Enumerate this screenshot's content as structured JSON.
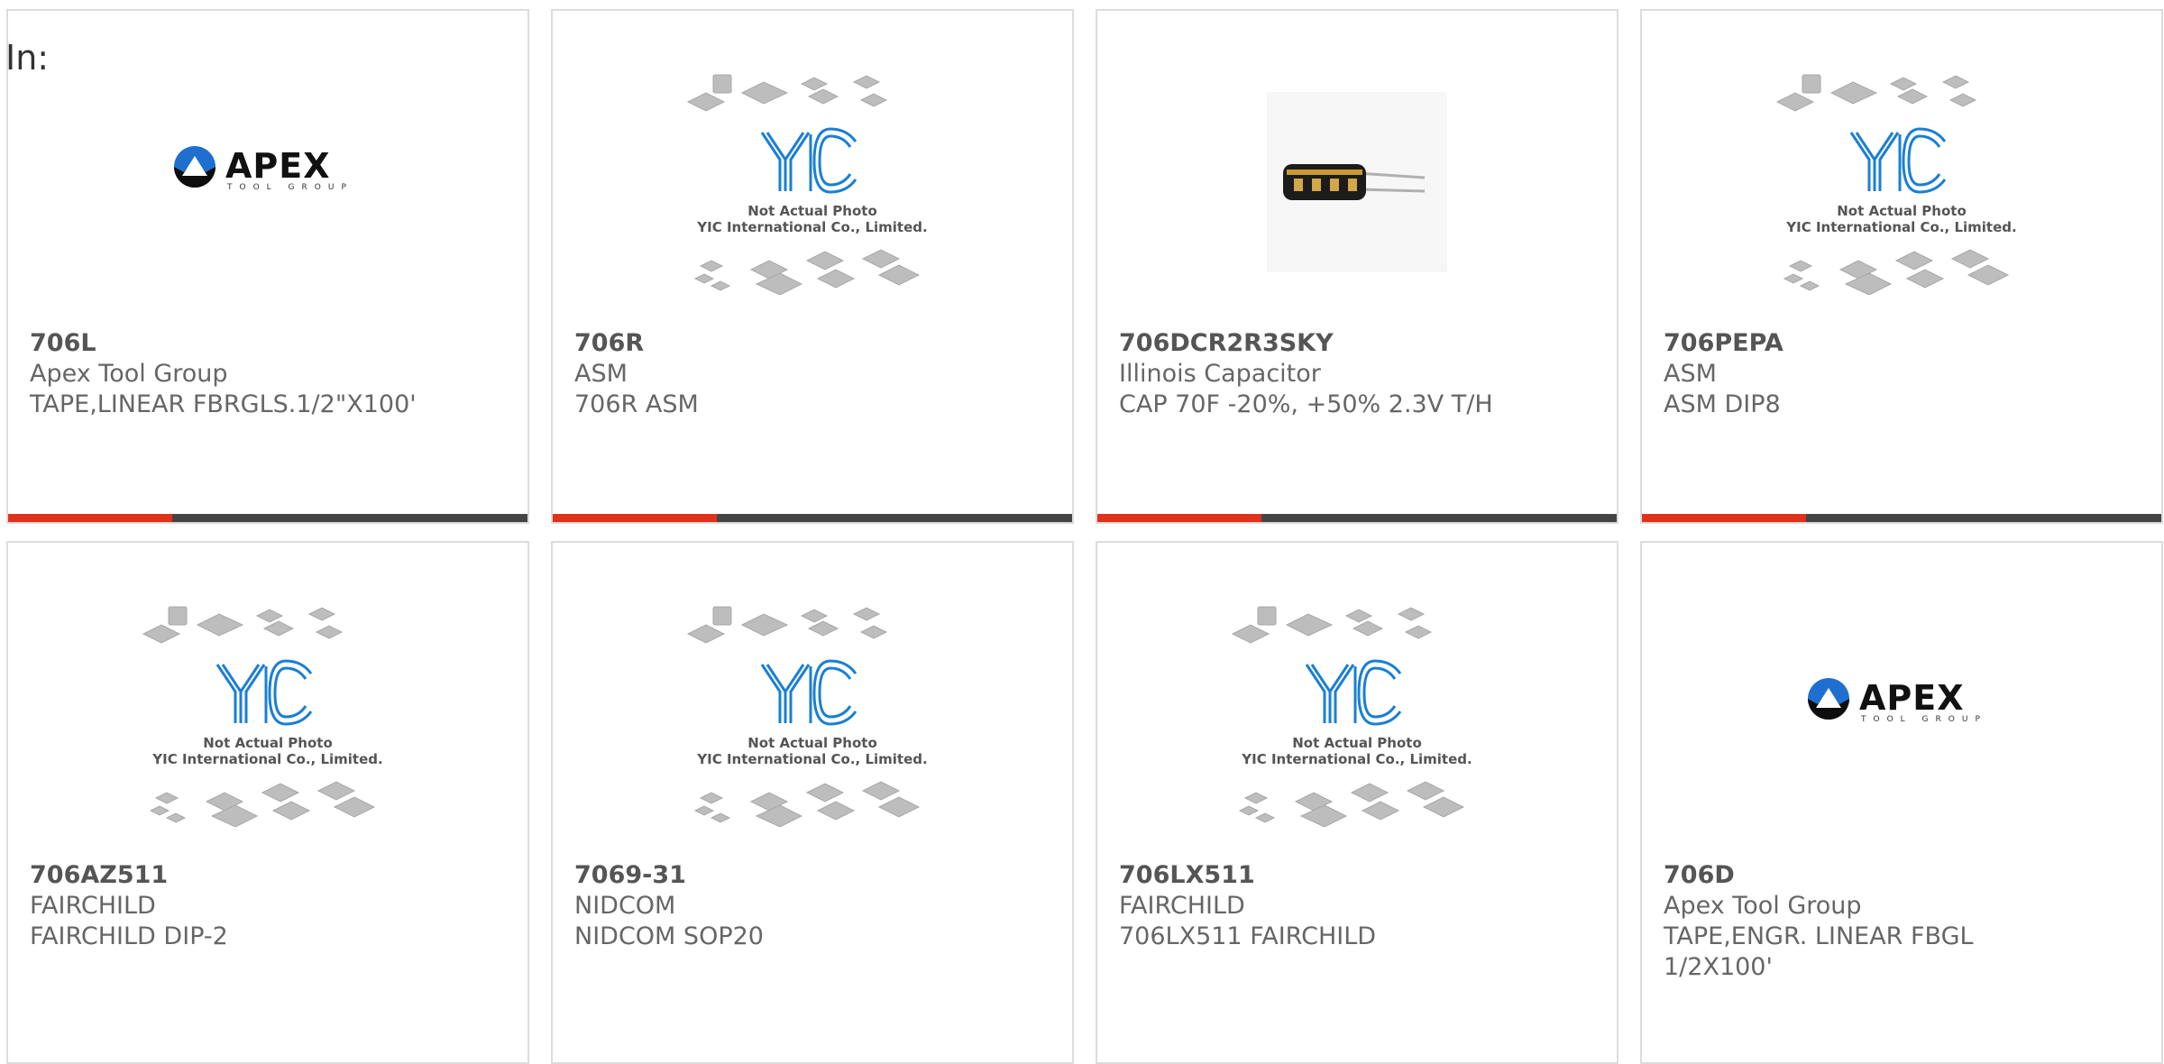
{
  "header": {
    "in_label": "In:"
  },
  "placeholder_text": {
    "line1": "Not Actual Photo",
    "line2": "YIC International Co., Limited.",
    "logo": "YIC"
  },
  "apex_logo": {
    "word": "APEX",
    "tag": "TOOL GROUP"
  },
  "colors": {
    "accent": "#e0321a",
    "bar": "#444444",
    "yic_blue": "#1a7fd4",
    "border": "#dcdcdc"
  },
  "products": [
    {
      "part": "706L",
      "maker": "Apex Tool Group",
      "desc": "TAPE,LINEAR FBRGLS.1/2\"X100'",
      "image": "apex-logo"
    },
    {
      "part": "706R",
      "maker": "ASM",
      "desc": "706R ASM",
      "image": "yic-placeholder"
    },
    {
      "part": "706DCR2R3SKY",
      "maker": "Illinois Capacitor",
      "desc": "CAP 70F -20%, +50% 2.3V T/H",
      "image": "capacitor-photo"
    },
    {
      "part": "706PEPA",
      "maker": "ASM",
      "desc": "ASM DIP8",
      "image": "yic-placeholder"
    },
    {
      "part": "706AZ511",
      "maker": "FAIRCHILD",
      "desc": "FAIRCHILD DIP-2",
      "image": "yic-placeholder"
    },
    {
      "part": "7069-31",
      "maker": "NIDCOM",
      "desc": "NIDCOM SOP20",
      "image": "yic-placeholder"
    },
    {
      "part": "706LX511",
      "maker": "FAIRCHILD",
      "desc": "706LX511 FAIRCHILD",
      "image": "yic-placeholder"
    },
    {
      "part": "706D",
      "maker": "Apex Tool Group",
      "desc": "TAPE,ENGR. LINEAR FBGL",
      "desc2": "1/2X100'",
      "image": "apex-logo"
    }
  ]
}
